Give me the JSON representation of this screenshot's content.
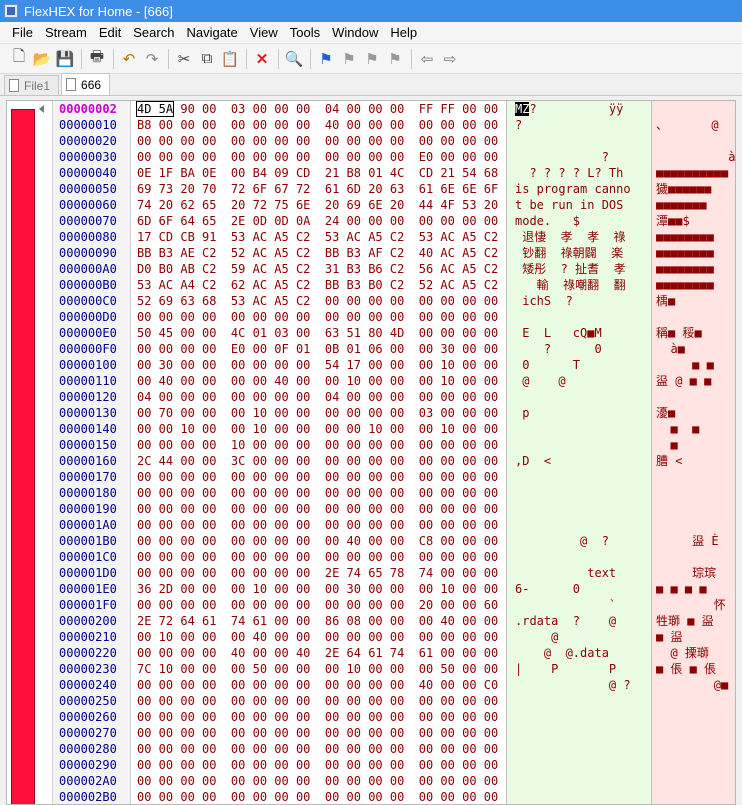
{
  "window": {
    "title": "FlexHEX for Home - [666]"
  },
  "menu": [
    "File",
    "Stream",
    "Edit",
    "Search",
    "Navigate",
    "View",
    "Tools",
    "Window",
    "Help"
  ],
  "toolbar": {
    "icons": [
      "new-icon",
      "open-icon",
      "save-icon",
      "print-icon",
      "undo-icon",
      "redo-icon",
      "cut-icon",
      "copy-icon",
      "paste-icon",
      "delete-icon",
      "find-icon",
      "bookmark-icon",
      "bookmark-next-icon",
      "bookmark-prev-icon",
      "bookmark-clear-icon",
      "back-icon",
      "forward-icon"
    ]
  },
  "tabs": [
    {
      "label": "File1",
      "active": false
    },
    {
      "label": "666",
      "active": true
    }
  ],
  "hex": {
    "current_offset": "00000002",
    "selected_bytes": "4D 5A",
    "rows": [
      {
        "addr": "00000002",
        "hex": "90 00  03 00 00 00  04 00 00 00  FF FF 00 00",
        "ascii": "?          ÿÿ",
        "u16": ""
      },
      {
        "addr": "00000010",
        "hex": "B8 00 00 00  00 00 00 00  40 00 00 00  00 00 00 00",
        "ascii": "?",
        "u16": "、      @"
      },
      {
        "addr": "00000020",
        "hex": "00 00 00 00  00 00 00 00  00 00 00 00  00 00 00 00",
        "ascii": "",
        "u16": ""
      },
      {
        "addr": "00000030",
        "hex": "00 00 00 00  00 00 00 00  00 00 00 00  E0 00 00 00",
        "ascii": "            ?",
        "u16": "          à"
      },
      {
        "addr": "00000040",
        "hex": "0E 1F BA 0E  00 B4 09 CD  21 B8 01 4C  CD 21 54 68",
        "ascii": "  ? ? ? ? L? Th",
        "u16": "■■■■■■■■■■"
      },
      {
        "addr": "00000050",
        "hex": "69 73 20 70  72 6F 67 72  61 6D 20 63  61 6E 6E 6F",
        "ascii": "is program canno",
        "u16": "獩■■■■■■"
      },
      {
        "addr": "00000060",
        "hex": "74 20 62 65  20 72 75 6E  20 69 6E 20  44 4F 53 20",
        "ascii": "t be run in DOS ",
        "u16": "■■■■■■■"
      },
      {
        "addr": "00000070",
        "hex": "6D 6F 64 65  2E 0D 0D 0A  24 00 00 00  00 00 00 00",
        "ascii": "mode.   $",
        "u16": "潭■■$"
      },
      {
        "addr": "00000080",
        "hex": "17 CD CB 91  53 AC A5 C2  53 AC A5 C2  53 AC A5 C2",
        "ascii": " 退悽  孝  孝  祿",
        "u16": "■■■■■■■■"
      },
      {
        "addr": "00000090",
        "hex": "BB B3 AE C2  52 AC A5 C2  BB B3 AF C2  40 AC A5 C2",
        "ascii": " 钞翻  祿朝闢  楽",
        "u16": "■■■■■■■■"
      },
      {
        "addr": "000000A0",
        "hex": "D0 B0 AB C2  59 AC A5 C2  31 B3 B6 C2  56 AC A5 C2",
        "ascii": " 矮彤  ? 扯耆  孝",
        "u16": "■■■■■■■■"
      },
      {
        "addr": "000000B0",
        "hex": "53 AC A4 C2  62 AC A5 C2  BB B3 B0 C2  52 AC A5 C2",
        "ascii": "   輸  祿嘲翻  翻",
        "u16": "■■■■■■■■"
      },
      {
        "addr": "000000C0",
        "hex": "52 69 63 68  53 AC A5 C2  00 00 00 00  00 00 00 00",
        "ascii": " ichS  ?",
        "u16": "楀■"
      },
      {
        "addr": "000000D0",
        "hex": "00 00 00 00  00 00 00 00  00 00 00 00  00 00 00 00",
        "ascii": "",
        "u16": ""
      },
      {
        "addr": "000000E0",
        "hex": "50 45 00 00  4C 01 03 00  63 51 80 4D  00 00 00 00",
        "ascii": " E  L   cQ■M",
        "u16": "稱■ 䅑■"
      },
      {
        "addr": "000000F0",
        "hex": "00 00 00 00  E0 00 0F 01  0B 01 06 00  00 30 00 00",
        "ascii": "    ?      0",
        "u16": "  à■"
      },
      {
        "addr": "00000100",
        "hex": "00 30 00 00  00 00 00 00  54 17 00 00  00 10 00 00",
        "ascii": " 0      T",
        "u16": "     ■ ■"
      },
      {
        "addr": "00000110",
        "hex": "00 40 00 00  00 00 40 00  00 10 00 00  00 10 00 00",
        "ascii": " @    @",
        "u16": "䀀 @ ■ ■"
      },
      {
        "addr": "00000120",
        "hex": "04 00 00 00  00 00 00 00  04 00 00 00  00 00 00 00",
        "ascii": "",
        "u16": ""
      },
      {
        "addr": "00000130",
        "hex": "00 70 00 00  00 10 00 00  00 00 00 00  03 00 00 00",
        "ascii": " p",
        "u16": "瀀■"
      },
      {
        "addr": "00000140",
        "hex": "00 00 10 00  00 10 00 00  00 00 10 00  00 10 00 00",
        "ascii": "",
        "u16": "  ■  ■"
      },
      {
        "addr": "00000150",
        "hex": "00 00 00 00  10 00 00 00  00 00 00 00  00 00 00 00",
        "ascii": "",
        "u16": "  ■"
      },
      {
        "addr": "00000160",
        "hex": "2C 44 00 00  3C 00 00 00  00 00 00 00  00 00 00 00",
        "ascii": ",D  <",
        "u16": "䐬 <"
      },
      {
        "addr": "00000170",
        "hex": "00 00 00 00  00 00 00 00  00 00 00 00  00 00 00 00",
        "ascii": "",
        "u16": ""
      },
      {
        "addr": "00000180",
        "hex": "00 00 00 00  00 00 00 00  00 00 00 00  00 00 00 00",
        "ascii": "",
        "u16": ""
      },
      {
        "addr": "00000190",
        "hex": "00 00 00 00  00 00 00 00  00 00 00 00  00 00 00 00",
        "ascii": "",
        "u16": ""
      },
      {
        "addr": "000001A0",
        "hex": "00 00 00 00  00 00 00 00  00 00 00 00  00 00 00 00",
        "ascii": "",
        "u16": ""
      },
      {
        "addr": "000001B0",
        "hex": "00 00 00 00  00 00 00 00  00 40 00 00  C8 00 00 00",
        "ascii": "         @  ?",
        "u16": "     䀀 È"
      },
      {
        "addr": "000001C0",
        "hex": "00 00 00 00  00 00 00 00  00 00 00 00  00 00 00 00",
        "ascii": "",
        "u16": ""
      },
      {
        "addr": "000001D0",
        "hex": "00 00 00 00  00 00 00 00  2E 74 65 78  74 00 00 00",
        "ascii": "          text",
        "u16": "     琮瑸"
      },
      {
        "addr": "000001E0",
        "hex": "36 2D 00 00  00 10 00 00  00 30 00 00  00 10 00 00",
        "ascii": "6-      0",
        "u16": "■ ■ ■ ■"
      },
      {
        "addr": "000001F0",
        "hex": "00 00 00 00  00 00 00 00  00 00 00 00  20 00 00 60",
        "ascii": "             `",
        "u16": "        怀"
      },
      {
        "addr": "00000200",
        "hex": "2E 72 64 61  74 61 00 00  86 08 00 00  00 40 00 00",
        "ascii": ".rdata  ?    @",
        "u16": "牲瑡 ■ 䀀"
      },
      {
        "addr": "00000210",
        "hex": "00 10 00 00  00 40 00 00  00 00 00 00  00 00 00 00",
        "ascii": "     @",
        "u16": "■ 䀀"
      },
      {
        "addr": "00000220",
        "hex": "00 00 00 00  40 00 00 40  2E 64 61 74  61 00 00 00",
        "ascii": "    @  @.data",
        "u16": "  @ 搮瑡"
      },
      {
        "addr": "00000230",
        "hex": "7C 10 00 00  00 50 00 00  00 10 00 00  00 50 00 00",
        "ascii": "|    P       P",
        "u16": "■ 倀 ■ 倀"
      },
      {
        "addr": "00000240",
        "hex": "00 00 00 00  00 00 00 00  00 00 00 00  40 00 00 C0",
        "ascii": "             @ ?",
        "u16": "        @■"
      },
      {
        "addr": "00000250",
        "hex": "00 00 00 00  00 00 00 00  00 00 00 00  00 00 00 00",
        "ascii": "",
        "u16": ""
      },
      {
        "addr": "00000260",
        "hex": "00 00 00 00  00 00 00 00  00 00 00 00  00 00 00 00",
        "ascii": "",
        "u16": ""
      },
      {
        "addr": "00000270",
        "hex": "00 00 00 00  00 00 00 00  00 00 00 00  00 00 00 00",
        "ascii": "",
        "u16": ""
      },
      {
        "addr": "00000280",
        "hex": "00 00 00 00  00 00 00 00  00 00 00 00  00 00 00 00",
        "ascii": "",
        "u16": ""
      },
      {
        "addr": "00000290",
        "hex": "00 00 00 00  00 00 00 00  00 00 00 00  00 00 00 00",
        "ascii": "",
        "u16": ""
      },
      {
        "addr": "000002A0",
        "hex": "00 00 00 00  00 00 00 00  00 00 00 00  00 00 00 00",
        "ascii": "",
        "u16": ""
      },
      {
        "addr": "000002B0",
        "hex": "00 00 00 00  00 00 00 00  00 00 00 00  00 00 00 00",
        "ascii": "",
        "u16": ""
      }
    ]
  },
  "colors": {
    "title_bg": "#3d8ee6",
    "ascii_bg": "#e9fbe2",
    "unicode_bg": "#ffe4e1",
    "marker_red": "#ff0f3c",
    "hex_text": "#8b0000",
    "addr_text": "#00008b"
  }
}
